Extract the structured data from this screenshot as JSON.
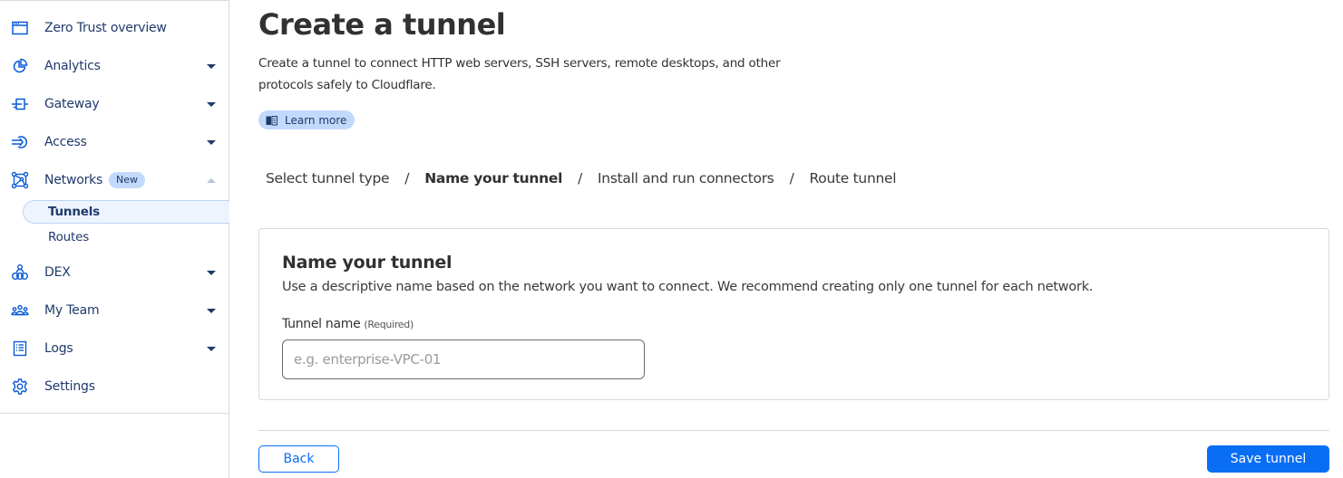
{
  "sidebar": {
    "items": [
      {
        "label": "Zero Trust overview",
        "icon": "browser-window-icon",
        "caret": "none"
      },
      {
        "label": "Analytics",
        "icon": "pie-chart-icon",
        "caret": "down"
      },
      {
        "label": "Gateway",
        "icon": "gateway-icon",
        "caret": "down"
      },
      {
        "label": "Access",
        "icon": "access-sign-in-icon",
        "caret": "down"
      },
      {
        "label": "Networks",
        "icon": "network-nodes-icon",
        "caret": "up",
        "badge": "New"
      },
      {
        "label": "DEX",
        "icon": "dex-icon",
        "caret": "down"
      },
      {
        "label": "My Team",
        "icon": "team-users-icon",
        "caret": "down"
      },
      {
        "label": "Logs",
        "icon": "logs-list-icon",
        "caret": "down"
      },
      {
        "label": "Settings",
        "icon": "gear-icon",
        "caret": "none"
      }
    ],
    "networks_subitems": [
      {
        "label": "Tunnels",
        "active": true
      },
      {
        "label": "Routes",
        "active": false
      }
    ]
  },
  "header": {
    "title": "Create a tunnel",
    "description": "Create a tunnel to connect HTTP web servers, SSH servers, remote desktops, and other protocols safely to Cloudflare.",
    "learn_more": "Learn more"
  },
  "breadcrumb": {
    "steps": [
      "Select tunnel type",
      "Name your tunnel",
      "Install and run connectors",
      "Route tunnel"
    ],
    "current_index": 1,
    "separator": "/"
  },
  "card": {
    "title": "Name your tunnel",
    "description": "Use a descriptive name based on the network you want to connect. We recommend creating only one tunnel for each network.",
    "field_label": "Tunnel name",
    "field_required": "(Required)",
    "input_value": "",
    "input_placeholder": "e.g. enterprise-VPC-01"
  },
  "footer": {
    "back_label": "Back",
    "save_label": "Save tunnel"
  },
  "colors": {
    "nav_text": "#1f3a6b",
    "icon": "#0a5ad6",
    "accent": "#0a6ef5",
    "badge_bg": "#c3d9fb"
  }
}
